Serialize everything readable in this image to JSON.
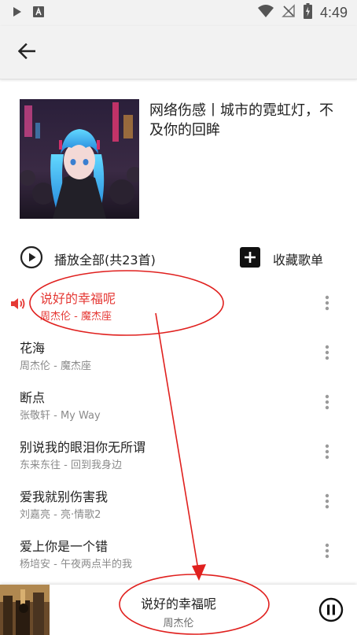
{
  "status_bar": {
    "time": "4:49"
  },
  "header": {
    "back_icon": "arrow-left-icon",
    "playlist_title": "网络伤感丨城市的霓虹灯，不及你的回眸"
  },
  "actions": {
    "play_all_label": "播放全部(共23首)",
    "collect_label": "收藏歌单"
  },
  "songs": [
    {
      "title": "说好的幸福呢",
      "subtitle": "周杰伦 - 魔杰座",
      "playing": true
    },
    {
      "title": "花海",
      "subtitle": "周杰伦 - 魔杰座",
      "playing": false
    },
    {
      "title": "断点",
      "subtitle": "张敬轩 - My Way",
      "playing": false
    },
    {
      "title": "别说我的眼泪你无所谓",
      "subtitle": "东来东往 - 回到我身边",
      "playing": false
    },
    {
      "title": "爱我就别伤害我",
      "subtitle": "刘嘉亮 - 亮·情歌2",
      "playing": false
    },
    {
      "title": "爱上你是一个错",
      "subtitle": "杨培安 - 午夜两点半的我",
      "playing": false
    }
  ],
  "player": {
    "title": "说好的幸福呢",
    "artist": "周杰伦",
    "state_icon": "pause-icon"
  },
  "colors": {
    "accent": "#e53935",
    "annotation": "#e0201e",
    "text_primary": "#212121",
    "text_secondary": "#8a8a8a",
    "bar_background": "#f2f2f2"
  }
}
